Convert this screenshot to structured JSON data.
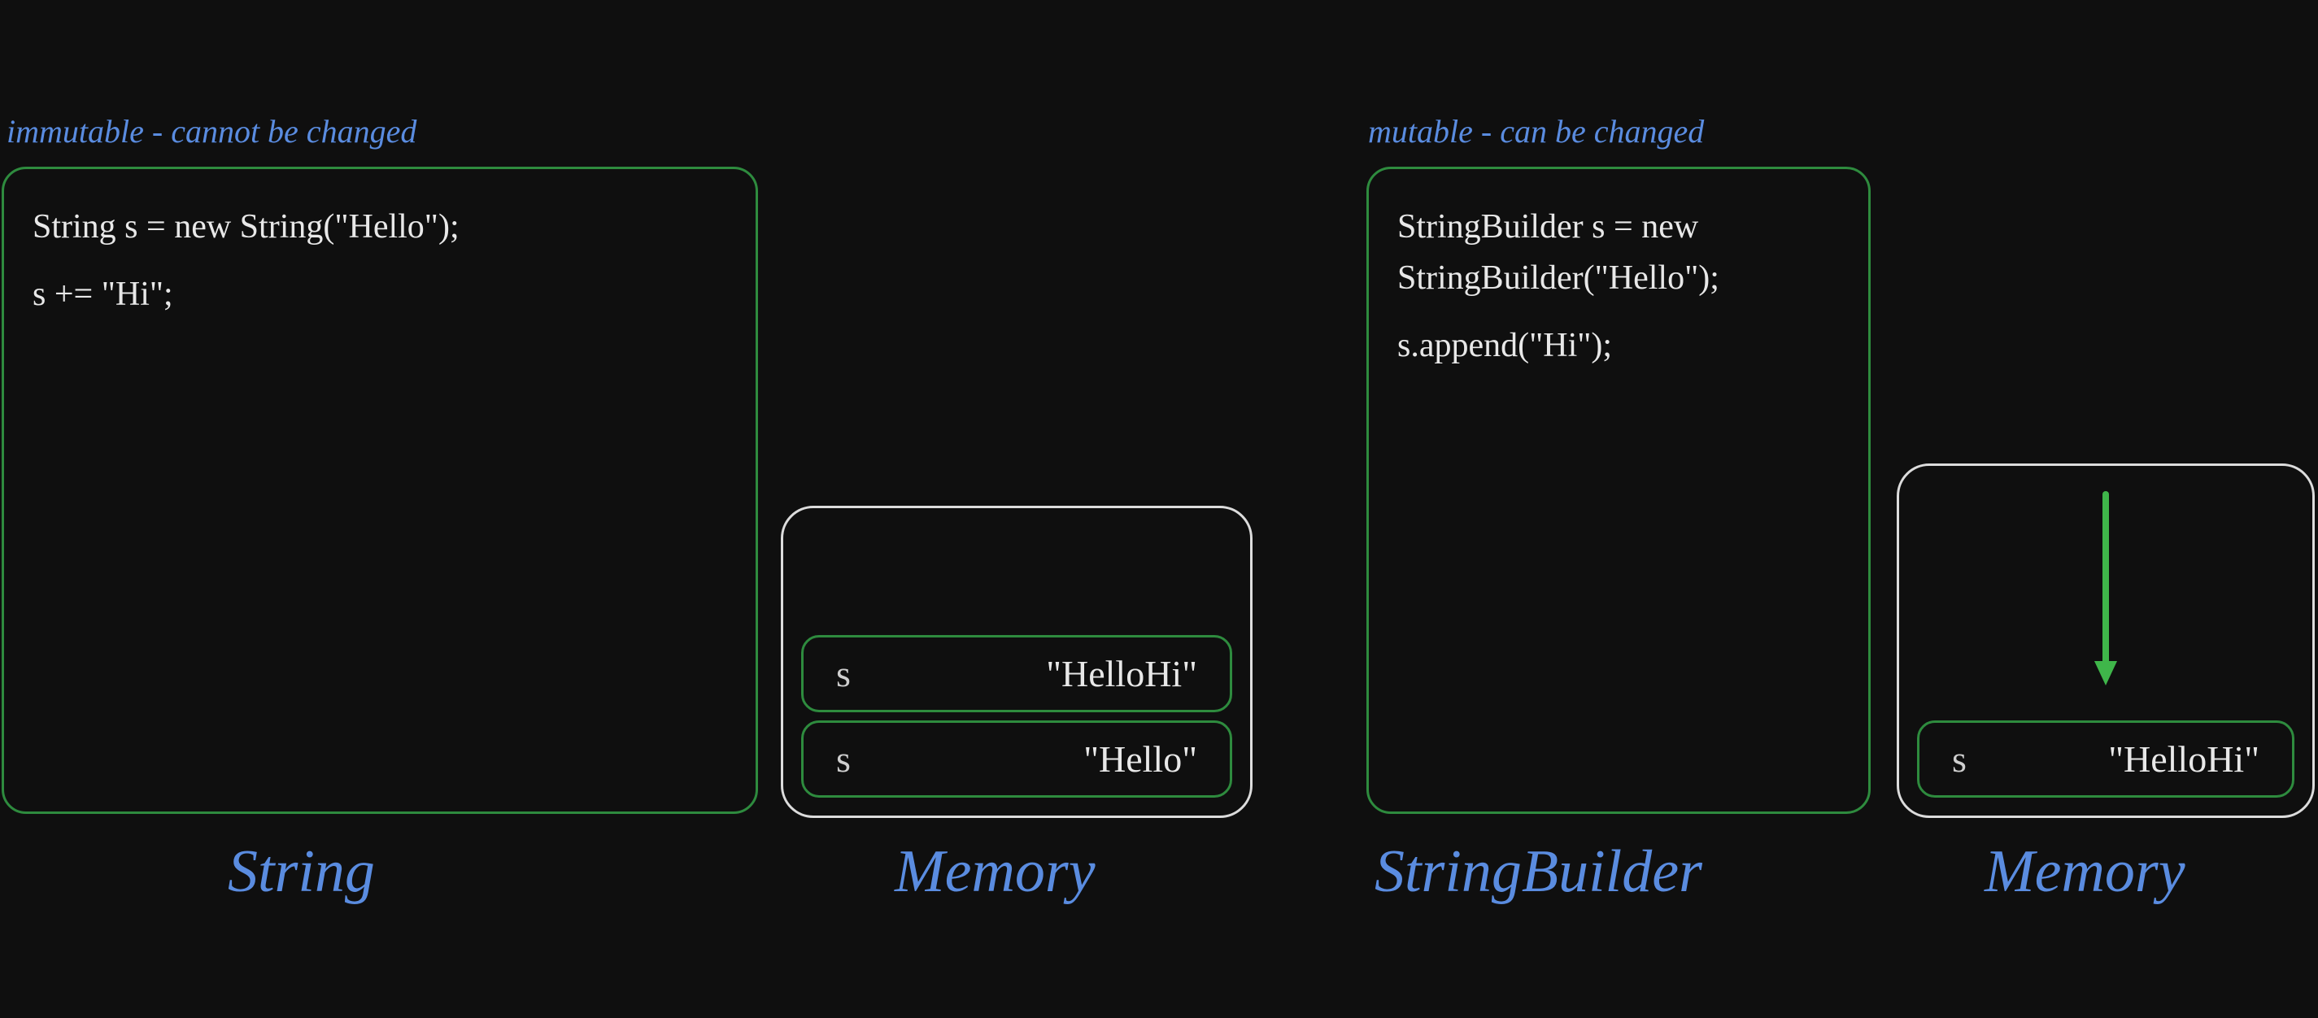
{
  "left": {
    "caption": "immutable - cannot be changed",
    "code": {
      "line1": "String s = new String(\"Hello\");",
      "line2": "s += \"Hi\";"
    },
    "memory": {
      "cells": [
        {
          "var": "s",
          "val": "\"HelloHi\""
        },
        {
          "var": "s",
          "val": "\"Hello\""
        }
      ]
    },
    "label_code": "String",
    "label_mem": "Memory"
  },
  "right": {
    "caption": "mutable - can be changed",
    "code": {
      "line1": "StringBuilder s = new",
      "line2": "StringBuilder(\"Hello\");",
      "line3": "s.append(\"Hi\");"
    },
    "memory": {
      "cells": [
        {
          "var": "s",
          "val": "\"HelloHi\""
        }
      ]
    },
    "label_code": "StringBuilder",
    "label_mem": "Memory"
  }
}
